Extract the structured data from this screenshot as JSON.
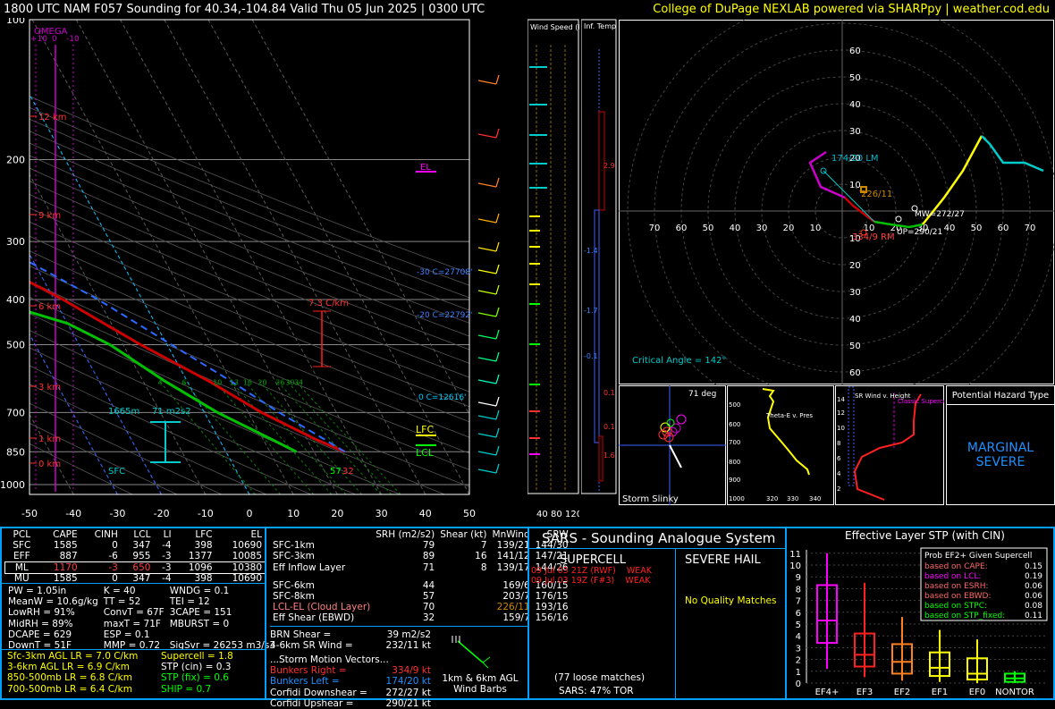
{
  "header": {
    "title": "1800 UTC NAM F057 Sounding for 40.34,-104.84 Valid  Thu 05 Jun 2025 | 0300 UTC",
    "credit": "College of DuPage NEXLAB powered via SHARPpy | weather.cod.edu"
  },
  "colors": {
    "temp": "#cc0000",
    "dew": "#00c000",
    "wetbulb": "#00b0ff",
    "parcel": "#ffffff",
    "accent": "#ffff00",
    "panel_border": "#00a0ff"
  },
  "skewt": {
    "omega_title": "OMEGA",
    "omega_ticks": [
      "+10",
      "0",
      "-10"
    ],
    "pressure_labels": [
      "100",
      "200",
      "300",
      "400",
      "500",
      "700",
      "850",
      "1000"
    ],
    "temp_labels": [
      "-50",
      "-40",
      "-30",
      "-20",
      "-10",
      "0",
      "10",
      "20",
      "30",
      "40",
      "50"
    ],
    "height_labels": [
      "12 km",
      "9 km",
      "6 km",
      "3 km",
      "1 km",
      "0 km"
    ],
    "annotations": {
      "el": "EL",
      "lfc": "LFC",
      "lcl": "LCL",
      "lapse": "7.3 C/km",
      "iso30": "-30 C=27708'",
      "iso20": "-20 C=22792'",
      "iso0": "0 C=12616'",
      "srh_layer": "71 m2s2",
      "srh_top": "1665m",
      "sfc": "SFC",
      "sfc_t": "32",
      "sfc_td": "57",
      "mixing_ratios": [
        "4",
        "6",
        "10",
        "13",
        "16",
        "20",
        "26",
        "30",
        "34"
      ]
    },
    "chart_data": {
      "type": "line",
      "title": "",
      "xlabel": "",
      "ylabel": "",
      "ylim": [
        1000,
        100
      ],
      "xlim": [
        -50,
        50
      ],
      "series": [
        {
          "name": "",
          "color": "#cc0000",
          "pressure": [
            850,
            800,
            700,
            600,
            500,
            400,
            300,
            250,
            200,
            150,
            100
          ],
          "values": [
            27,
            22,
            13,
            5,
            -6,
            -18,
            -36,
            -45,
            -52,
            -57,
            -60
          ]
        },
        {
          "name": "",
          "color": "#00c000",
          "pressure": [
            850,
            800,
            700,
            600,
            500,
            450,
            400,
            300,
            250,
            200,
            150,
            100
          ],
          "values": [
            16,
            12,
            3,
            -5,
            -13,
            -20,
            -35,
            -50,
            -60,
            -70,
            -75,
            -82
          ]
        }
      ]
    }
  },
  "wind_speed_panel": {
    "title": "Wind Speed (knots)",
    "ticks": [
      "40",
      "80",
      "120"
    ]
  },
  "inferred_temp_panel": {
    "title": "Inf. Temp. Adv. (C/hr)",
    "values": [
      "2.9",
      "-1.4",
      "-1.7",
      "-0.1",
      "0.1",
      "0.1",
      "1.6"
    ]
  },
  "hodograph": {
    "rings": [
      "10",
      "20",
      "30",
      "40",
      "50",
      "60",
      "70"
    ],
    "lm_label": "174/20 LM",
    "rm_label": "334/9 RM",
    "mean_label": "226/11",
    "mw_label": "MW=272/27",
    "up_label": "UP=290/21",
    "critical_angle": "Critical Angle = 142°",
    "chart_data": {
      "type": "line",
      "title": "",
      "series": [
        {
          "name": "",
          "color": "#cc0000",
          "u": [
            12,
            8,
            4,
            1
          ],
          "v": [
            -4,
            -1,
            2,
            5
          ]
        },
        {
          "name": "",
          "color": "#00c000",
          "u": [
            12,
            18,
            25,
            30
          ],
          "v": [
            -4,
            -5,
            -6,
            -5
          ]
        },
        {
          "name": "",
          "color": "#ffff00",
          "u": [
            30,
            38,
            45,
            52
          ],
          "v": [
            -5,
            5,
            15,
            28
          ]
        },
        {
          "name": "",
          "color": "#00cccc",
          "u": [
            52,
            55,
            60,
            68,
            75
          ],
          "v": [
            28,
            25,
            18,
            18,
            15
          ]
        },
        {
          "name": "",
          "color": "#cc00cc",
          "u": [
            1,
            -8,
            -12,
            -6
          ],
          "v": [
            5,
            9,
            18,
            22
          ]
        }
      ]
    }
  },
  "storm_slinky": {
    "title": "Storm Slinky",
    "angle": "71 deg"
  },
  "theta_e": {
    "title": "Theta-E v. Pres",
    "y_ticks": [
      "500",
      "600",
      "700",
      "800",
      "900",
      "1000"
    ],
    "x_ticks": [
      "320",
      "330",
      "340"
    ]
  },
  "sr_wind": {
    "title": "SR Wind v. Height",
    "label": "Classic Supercell",
    "y_ticks": [
      "14",
      "12",
      "10",
      "8",
      "6",
      "4",
      "2"
    ]
  },
  "hazard": {
    "title": "Potential Hazard Type",
    "value": "MARGINAL SEVERE"
  },
  "parcel_table": {
    "headers": [
      "PCL",
      "CAPE",
      "CINH",
      "LCL",
      "LI",
      "LFC",
      "EL"
    ],
    "rows": [
      [
        "SFC",
        "1585",
        "0",
        "347",
        "-4",
        "398",
        "10690"
      ],
      [
        "EFF",
        "887",
        "-6",
        "955",
        "-3",
        "1377",
        "10085"
      ],
      [
        "ML",
        "1170",
        "-3",
        "650",
        "-3",
        "1096",
        "10380"
      ],
      [
        "MU",
        "1585",
        "0",
        "347",
        "-4",
        "398",
        "10690"
      ]
    ]
  },
  "indices": [
    [
      "PW = 1.05in",
      "K = 40",
      "WNDG = 0.1"
    ],
    [
      "MeanW = 10.6g/kg",
      "TT = 52",
      "TEI = 12"
    ],
    [
      "LowRH = 91%",
      "ConvT = 67F",
      "3CAPE = 151"
    ],
    [
      "MidRH = 89%",
      "maxT = 71F",
      "MBURST = 0"
    ],
    [
      "DCAPE = 629",
      "ESP = 0.1",
      ""
    ],
    [
      "DownT = 51F",
      "MMP = 0.72",
      "SigSvr = 26253 m3/s3"
    ]
  ],
  "lapse_rates": [
    "Sfc-3km AGL LR = 7.0 C/km",
    "3-6km AGL LR = 6.9 C/km",
    "850-500mb LR = 6.8 C/km",
    "700-500mb LR = 6.4 C/km"
  ],
  "composites": [
    "Supercell = 1.8",
    "STP (cin) = 0.3",
    "STP (fix) = 0.6",
    "SHIP = 0.7"
  ],
  "kinematics": {
    "headers": [
      "SRH (m2/s2)",
      "Shear (kt)",
      "MnWind",
      "SRW"
    ],
    "rows": [
      [
        "SFC-1km",
        "79",
        "7",
        "139/21",
        "144/30"
      ],
      [
        "SFC-3km",
        "89",
        "16",
        "141/12",
        "147/21"
      ],
      [
        "Eff Inflow Layer",
        "71",
        "8",
        "139/17",
        "144/26"
      ],
      [
        "",
        "",
        "",
        "",
        ""
      ],
      [
        "SFC-6km",
        "44",
        "",
        "169/6",
        "160/15"
      ],
      [
        "SFC-8km",
        "57",
        "",
        "203/7",
        "176/15"
      ],
      [
        "LCL-EL (Cloud Layer)",
        "70",
        "",
        "226/11",
        "193/16"
      ],
      [
        "Eff Shear (EBWD)",
        "32",
        "",
        "159/7",
        "156/16"
      ]
    ],
    "brn": "BRN Shear =",
    "brn_val": "39 m2/s2",
    "srw46": "4-6km SR Wind =",
    "srw46_val": "232/11 kt",
    "motion_title": "...Storm Motion Vectors...",
    "motions": [
      [
        "Bunkers Right =",
        "334/9 kt"
      ],
      [
        "Bunkers Left =",
        "174/20 kt"
      ],
      [
        "Corfidi Downshear =",
        "272/27 kt"
      ],
      [
        "Corfidi Upshear =",
        "290/21 kt"
      ]
    ],
    "barb_label": "1km & 6km AGL Wind Barbs"
  },
  "sars": {
    "title": "SARS - Sounding Analogue System",
    "supercell": "SUPERCELL",
    "hail": "SEVERE HAIL",
    "matches": [
      "09 Jul 03 21Z (RWF)",
      "09 Jul 03 19Z (F#3)"
    ],
    "match_vals": [
      "WEAK",
      "WEAK"
    ],
    "hail_none": "No Quality Matches",
    "loose": "(77 loose matches)",
    "tor": "SARS: 47% TOR"
  },
  "stp": {
    "title": "Effective Layer STP (with CIN)",
    "prob_title": "Prob EF2+ Given Supercell",
    "probs": [
      [
        "based on CAPE:",
        "0.15",
        "#ff6666"
      ],
      [
        "based on LCL:",
        "0.19",
        "#ff00ff"
      ],
      [
        "based on ESRH:",
        "0.06",
        "#ff6666"
      ],
      [
        "based on EBWD:",
        "0.06",
        "#ff6666"
      ],
      [
        "based on STPC:",
        "0.08",
        "#00ff00"
      ],
      [
        "based on STP_fixed:",
        "0.11",
        "#00ff00"
      ]
    ],
    "y_ticks": [
      "11",
      "10",
      "9",
      "8",
      "7",
      "6",
      "5",
      "4",
      "3",
      "2",
      "1",
      "0"
    ],
    "categories": [
      "EF4+",
      "EF3",
      "EF2",
      "EF1",
      "EF0",
      "NONTOR"
    ],
    "chart_data": {
      "type": "bar",
      "categories": [
        "EF4+",
        "EF3",
        "EF2",
        "EF1",
        "EF0",
        "NONTOR"
      ],
      "colors": [
        "#ff00ff",
        "#ff2020",
        "#ff8020",
        "#ffff00",
        "#ffff00",
        "#00ff00"
      ],
      "whisker_low": [
        1.2,
        0.5,
        0.2,
        0.1,
        0.0,
        0.0
      ],
      "q1": [
        3.4,
        1.4,
        0.8,
        0.6,
        0.3,
        0.1
      ],
      "median": [
        5.3,
        2.4,
        1.8,
        1.3,
        0.8,
        0.4
      ],
      "q3": [
        8.3,
        4.2,
        3.3,
        2.6,
        2.1,
        0.8
      ],
      "whisker_high": [
        11.0,
        8.5,
        5.6,
        4.5,
        3.7,
        1.0
      ]
    }
  }
}
